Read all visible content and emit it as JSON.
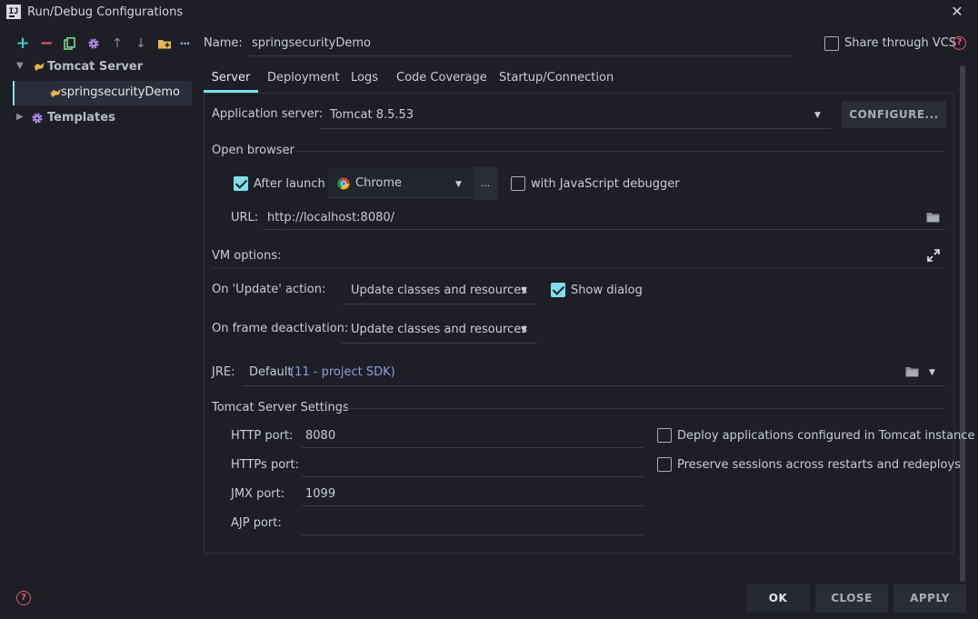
{
  "window": {
    "title": "Run/Debug Configurations",
    "logo_text": "IJ",
    "close_glyph": "✕"
  },
  "toolbar": {
    "icons": [
      "add-icon",
      "remove-icon",
      "copy-icon",
      "settings-icon",
      "move-up-icon",
      "move-down-icon",
      "folder-add-icon",
      "more-icon"
    ],
    "add": "+",
    "remove": "−",
    "up": "↑",
    "down": "↓",
    "more": "···"
  },
  "tree": {
    "group": "Tomcat Server",
    "item": "springsecurityDemo",
    "templates": "Templates"
  },
  "name_field": {
    "label": "Name:",
    "value": "springsecurityDemo"
  },
  "share": {
    "label": "Share through VCS"
  },
  "tabs": [
    "Server",
    "Deployment",
    "Logs",
    "Code Coverage",
    "Startup/Connection"
  ],
  "active_tab": "Server",
  "server": {
    "app_server_label": "Application server:",
    "app_server_value": "Tomcat 8.5.53",
    "configure_label": "CONFIGURE...",
    "open_browser_title": "Open browser",
    "after_launch_label": "After launch",
    "after_launch_checked": true,
    "browser_value": "Chrome",
    "browse_button": "...",
    "js_debugger_label": "with JavaScript debugger",
    "js_debugger_checked": false,
    "url_label": "URL:",
    "url_value": "http://localhost:8080/",
    "vm_options_label": "VM options:",
    "update_action_label": "On 'Update' action:",
    "update_action_value": "Update classes and resources",
    "show_dialog_label": "Show dialog",
    "show_dialog_checked": true,
    "frame_deactivation_label": "On frame deactivation:",
    "frame_deactivation_value": "Update classes and resources",
    "jre_label": "JRE:",
    "jre_value": "Default",
    "jre_hint": "(11 - project SDK)",
    "tomcat_settings_title": "Tomcat Server Settings",
    "http_port_label": "HTTP port:",
    "http_port_value": "8080",
    "https_port_label": "HTTPs port:",
    "https_port_value": "",
    "jmx_port_label": "JMX port:",
    "jmx_port_value": "1099",
    "ajp_port_label": "AJP port:",
    "ajp_port_value": "",
    "deploy_configured_label": "Deploy applications configured in Tomcat instance",
    "preserve_sessions_label": "Preserve sessions across restarts and redeploys"
  },
  "footer": {
    "ok": "OK",
    "close": "CLOSE",
    "apply": "APPLY"
  },
  "colors": {
    "accent": "#7fe0e8",
    "add": "#39d2c0",
    "remove": "#e05a6a",
    "copy": "#7bd88f",
    "settings": "#b48cf2",
    "help": "#e05a6a",
    "folder": "#e5b84a"
  }
}
